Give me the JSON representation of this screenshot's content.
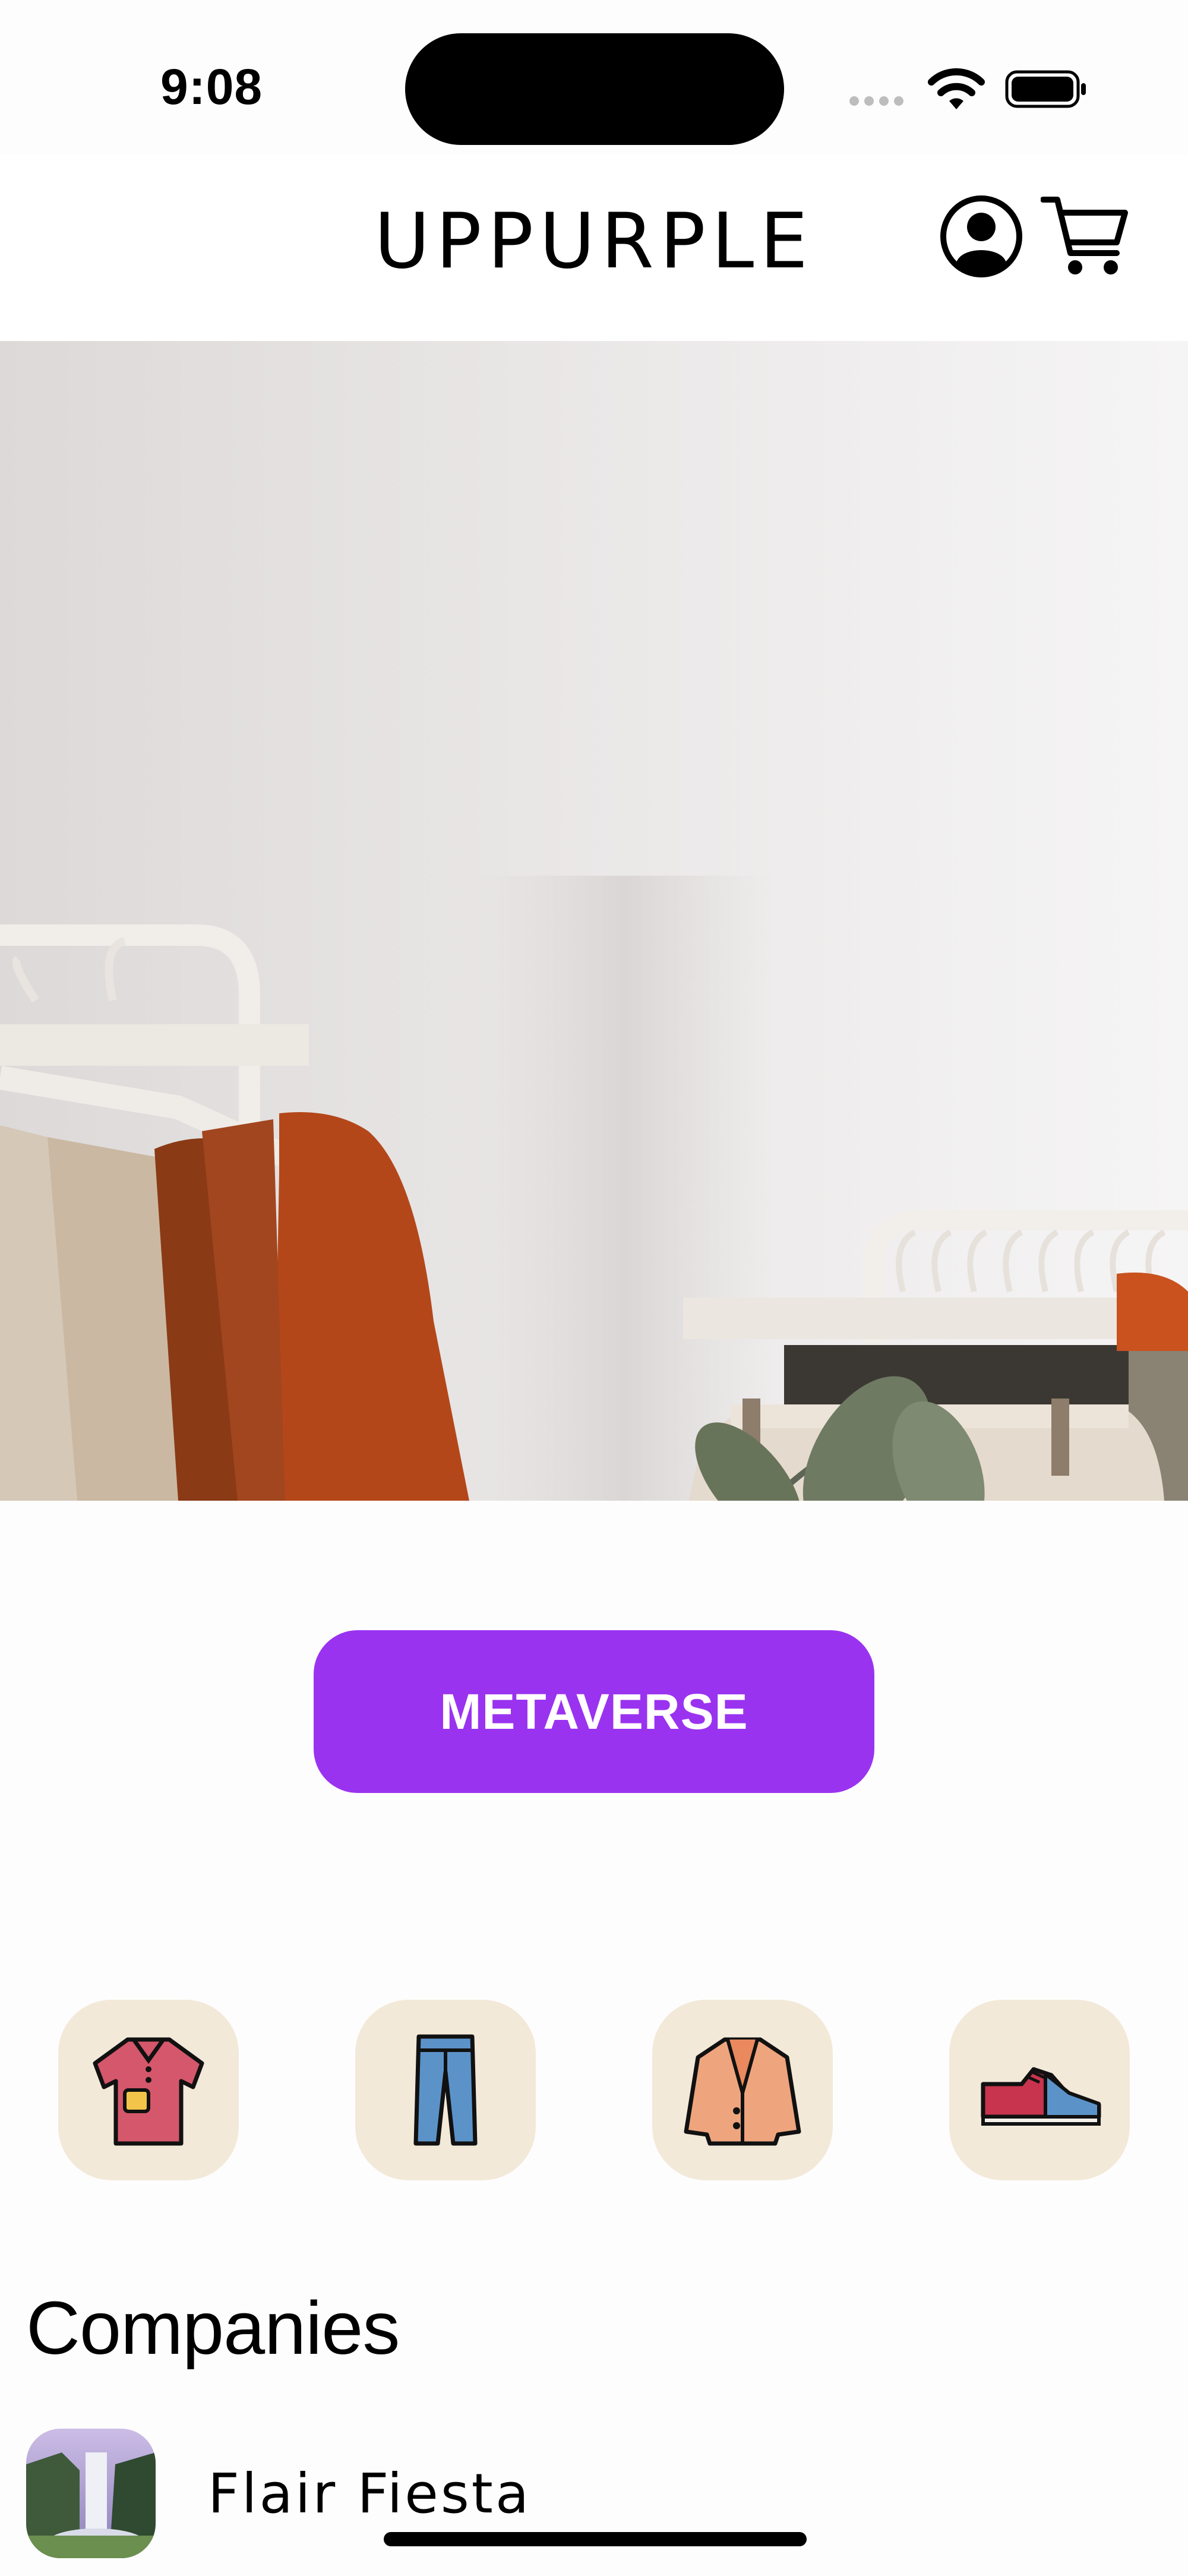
{
  "status_bar": {
    "time": "9:08"
  },
  "header": {
    "brand": "UPPURPLE",
    "account_icon": "account-icon",
    "cart_icon": "cart-icon"
  },
  "hero": {
    "description_icon": "clothing-rack-photo"
  },
  "cta": {
    "label": "METAVERSE",
    "color": "#9a33f0"
  },
  "categories": [
    {
      "name": "shirt-icon"
    },
    {
      "name": "jeans-icon"
    },
    {
      "name": "jacket-icon"
    },
    {
      "name": "sneaker-icon"
    }
  ],
  "companies": {
    "title": "Companies",
    "items": [
      {
        "name": "Flair Fiesta"
      }
    ]
  },
  "colors": {
    "accent": "#9a33f0",
    "category_bg": "#f3e9d9"
  }
}
